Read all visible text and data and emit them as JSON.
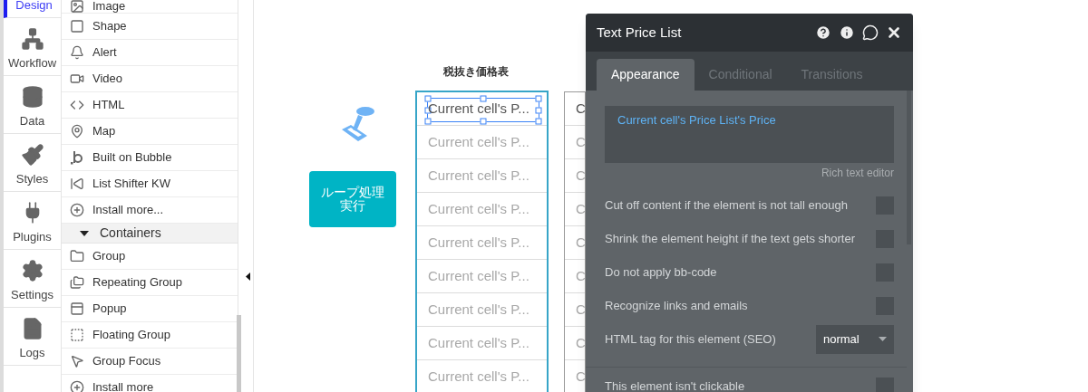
{
  "nav": [
    {
      "label": "Design",
      "selected": true
    },
    {
      "label": "Workflow",
      "selected": false
    },
    {
      "label": "Data",
      "selected": false
    },
    {
      "label": "Styles",
      "selected": false
    },
    {
      "label": "Plugins",
      "selected": false
    },
    {
      "label": "Settings",
      "selected": false
    },
    {
      "label": "Logs",
      "selected": false
    }
  ],
  "elements": [
    {
      "kind": "item",
      "label": "Image"
    },
    {
      "kind": "item",
      "label": "Shape"
    },
    {
      "kind": "item",
      "label": "Alert"
    },
    {
      "kind": "item",
      "label": "Video"
    },
    {
      "kind": "item",
      "label": "HTML"
    },
    {
      "kind": "item",
      "label": "Map"
    },
    {
      "kind": "item",
      "label": "Built on Bubble"
    },
    {
      "kind": "item",
      "label": "List Shifter KW"
    },
    {
      "kind": "item",
      "label": "Install more..."
    },
    {
      "kind": "header",
      "label": "Containers",
      "expanded": true
    },
    {
      "kind": "item",
      "label": "Group"
    },
    {
      "kind": "item",
      "label": "Repeating Group"
    },
    {
      "kind": "item",
      "label": "Popup"
    },
    {
      "kind": "item",
      "label": "Floating Group"
    },
    {
      "kind": "item",
      "label": "Group Focus"
    },
    {
      "kind": "item",
      "label": "Install more"
    }
  ],
  "canvas": {
    "button": "ループ処理実行",
    "table_title": "税抜き価格表",
    "table_1": [
      {
        "text": "Current cell's P...",
        "selected": true,
        "dimmed": false
      },
      {
        "text": "Current cell's P...",
        "selected": false,
        "dimmed": true
      },
      {
        "text": "Current cell's P...",
        "selected": false,
        "dimmed": true
      },
      {
        "text": "Current cell's P...",
        "selected": false,
        "dimmed": true
      },
      {
        "text": "Current cell's P...",
        "selected": false,
        "dimmed": true
      },
      {
        "text": "Current cell's P...",
        "selected": false,
        "dimmed": true
      },
      {
        "text": "Current cell's P...",
        "selected": false,
        "dimmed": true
      },
      {
        "text": "Current cell's P...",
        "selected": false,
        "dimmed": true
      },
      {
        "text": "Current cell's P...",
        "selected": false,
        "dimmed": true
      }
    ],
    "table_2": [
      {
        "text": "C",
        "dimmed": false
      },
      {
        "text": "C",
        "dimmed": true
      },
      {
        "text": "C",
        "dimmed": true
      },
      {
        "text": "C",
        "dimmed": true
      },
      {
        "text": "C",
        "dimmed": true
      },
      {
        "text": "C",
        "dimmed": true
      },
      {
        "text": "C",
        "dimmed": true
      },
      {
        "text": "C",
        "dimmed": true
      },
      {
        "text": "C",
        "dimmed": true
      }
    ]
  },
  "panel": {
    "title": "Text Price List",
    "tabs": [
      {
        "label": "Appearance",
        "selected": true
      },
      {
        "label": "Conditional",
        "selected": false
      },
      {
        "label": "Transitions",
        "selected": false
      }
    ],
    "content": "Current cell's Price List's Price",
    "editor_link": "Rich text editor",
    "options": [
      {
        "kind": "checkbox",
        "label": "Cut off content if the element is not tall enough",
        "checked": false
      },
      {
        "kind": "checkbox",
        "label": "Shrink the element height if the text gets shorter",
        "checked": false
      },
      {
        "kind": "checkbox",
        "label": "Do not apply bb-code",
        "checked": false
      },
      {
        "kind": "checkbox",
        "label": "Recognize links and emails",
        "checked": false
      },
      {
        "kind": "select",
        "label": "HTML tag for this element (SEO)",
        "value": "normal"
      },
      {
        "kind": "divider"
      },
      {
        "kind": "checkbox",
        "label": "This element isn't clickable",
        "checked": false
      }
    ]
  }
}
